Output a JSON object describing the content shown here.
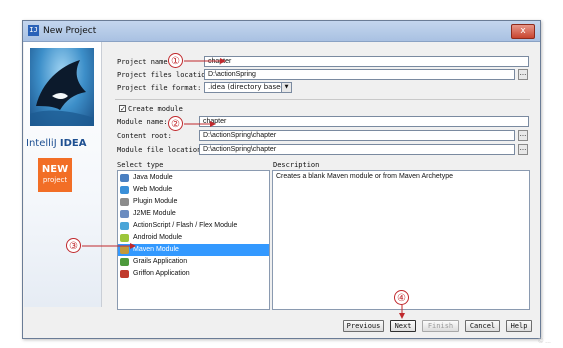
{
  "window": {
    "title": "New Project",
    "title_icon": "idea-icon",
    "close_glyph": "x"
  },
  "sidebar": {
    "logo_brand": "IntelliJ",
    "logo_product": "IDEA",
    "badge_new": "NEW",
    "badge_sub": "project"
  },
  "form": {
    "project_name_label": "Project name:",
    "project_name_value": "chapter",
    "project_files_label": "Project files location:",
    "project_files_value": "D:\\actionSpring",
    "project_format_label": "Project file format:",
    "project_format_value": ".idea (directory based)",
    "browse_glyph": "...",
    "create_module_label": "Create module",
    "create_module_checked": true,
    "module_name_label": "Module name:",
    "module_name_value": "chapter",
    "content_root_label": "Content root:",
    "content_root_value": "D:\\actionSpring\\chapter",
    "module_file_label": "Module file location:",
    "module_file_value": "D:\\actionSpring\\chapter"
  },
  "select_type": {
    "label": "Select type",
    "items": [
      {
        "label": "Java Module",
        "icon": "java-module-icon",
        "color": "#4a7fc1"
      },
      {
        "label": "Web Module",
        "icon": "web-module-icon",
        "color": "#3a8fd8"
      },
      {
        "label": "Plugin Module",
        "icon": "plugin-module-icon",
        "color": "#8c8c8c"
      },
      {
        "label": "J2ME Module",
        "icon": "j2me-module-icon",
        "color": "#6b8cc0"
      },
      {
        "label": "ActionScript / Flash / Flex Module",
        "icon": "flash-module-icon",
        "color": "#4aa5d8"
      },
      {
        "label": "Android Module",
        "icon": "android-module-icon",
        "color": "#9cc63a"
      },
      {
        "label": "Maven Module",
        "icon": "maven-module-icon",
        "color": "#c09a3c"
      },
      {
        "label": "Grails Application",
        "icon": "grails-icon",
        "color": "#4d9a3c"
      },
      {
        "label": "Griffon Application",
        "icon": "griffon-icon",
        "color": "#c0392b"
      }
    ],
    "selected_index": 6
  },
  "description": {
    "label": "Description",
    "text": "Creates a blank Maven module or from Maven Archetype"
  },
  "buttons": {
    "previous": "Previous",
    "next": "Next",
    "finish": "Finish",
    "cancel": "Cancel",
    "help": "Help"
  },
  "callouts": [
    "①",
    "②",
    "③",
    "④"
  ],
  "colors": {
    "accent": "#3399ff",
    "callout": "#c0282c",
    "badge": "#f26e26"
  },
  "watermark": "© ..."
}
